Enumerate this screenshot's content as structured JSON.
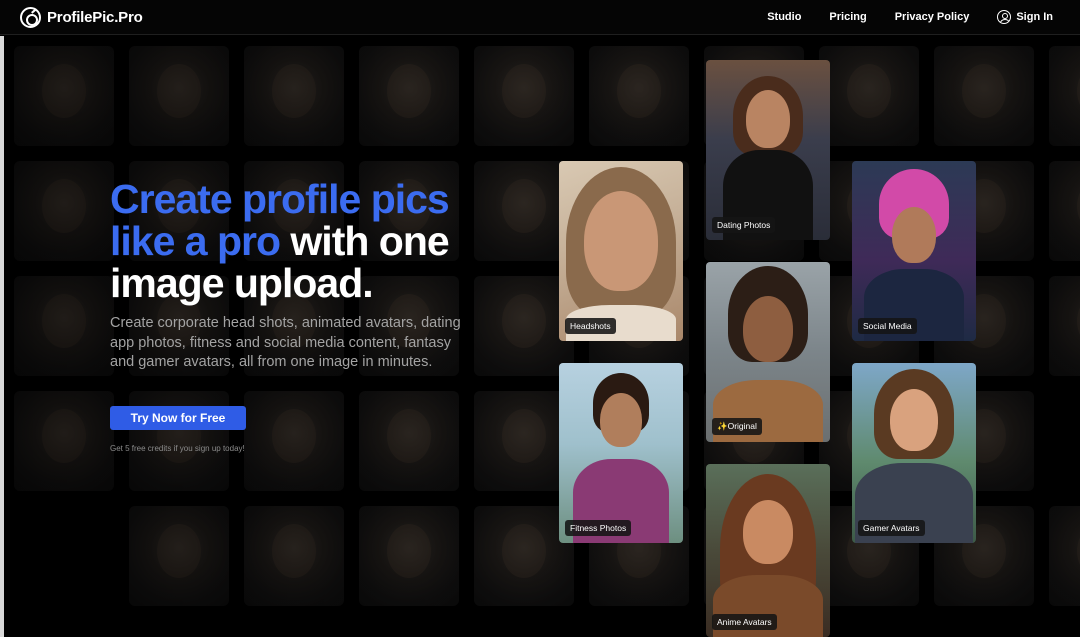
{
  "header": {
    "logo_text": "ProfilePic.Pro",
    "nav": {
      "studio": "Studio",
      "pricing": "Pricing",
      "privacy": "Privacy Policy",
      "sign_in": "Sign In"
    }
  },
  "hero": {
    "headline_blue_1": "Create profile pics",
    "headline_blue_2": "like a pro",
    "headline_white_1": " with one",
    "headline_white_2": "image upload.",
    "subtext": "Create corporate head shots, animated avatars, dating app photos, fitness and social media content, fantasy and gamer avatars, all from one image in minutes.",
    "cta_label": "Try Now for Free",
    "fine_print": "Get 5 free credits if you sign up today!"
  },
  "cards": {
    "headshots": "Headshots",
    "dating": "Dating Photos",
    "original": "✨Original",
    "social": "Social Media",
    "fitness": "Fitness Photos",
    "gamer": "Gamer Avatars",
    "anime": "Anime Avatars"
  },
  "colors": {
    "accent_blue": "#3b6cf0",
    "button_blue": "#2f5ce6",
    "background": "#000000"
  }
}
